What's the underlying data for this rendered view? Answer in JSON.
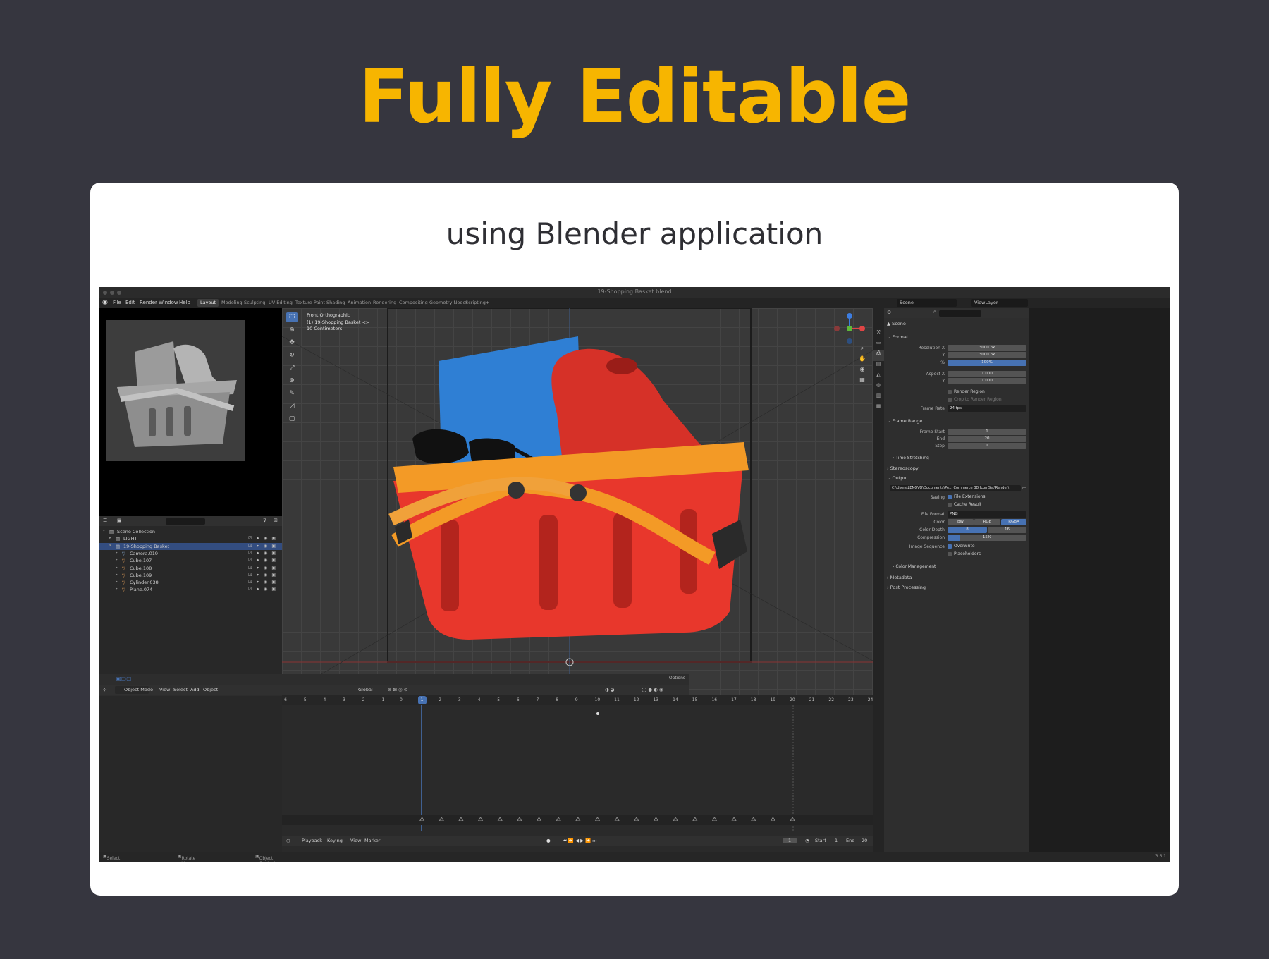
{
  "headline": "Fully Editable",
  "subtitle": "using Blender application",
  "colors": {
    "accent": "#f7b500",
    "background": "#36363f",
    "selection": "#4772b3"
  },
  "blender": {
    "window_title": "19-Shopping Basket.blend",
    "menus": [
      "File",
      "Edit",
      "Render",
      "Window",
      "Help"
    ],
    "workspaces": [
      "Layout",
      "Modeling",
      "Sculpting",
      "UV Editing",
      "Texture Paint",
      "Shading",
      "Animation",
      "Rendering",
      "Compositing",
      "Geometry Nodes",
      "Scripting",
      "+"
    ],
    "active_workspace": "Layout",
    "scene_field": "Scene",
    "view_layer_field": "ViewLayer",
    "outliner": {
      "rows": [
        {
          "label": "Scene Collection",
          "level": 0,
          "selected": false
        },
        {
          "label": "LIGHT",
          "level": 1,
          "selected": false
        },
        {
          "label": "19-Shopping Basket",
          "level": 1,
          "selected": true
        },
        {
          "label": "Camera.019",
          "level": 2,
          "selected": false
        },
        {
          "label": "Cube.107",
          "level": 2,
          "selected": false
        },
        {
          "label": "Cube.108",
          "level": 2,
          "selected": false
        },
        {
          "label": "Cube.109",
          "level": 2,
          "selected": false
        },
        {
          "label": "Cylinder.038",
          "level": 2,
          "selected": false
        },
        {
          "label": "Plane.074",
          "level": 2,
          "selected": false
        }
      ]
    },
    "viewport": {
      "info": [
        "Front Orthographic",
        "(1) 19-Shopping Basket <>",
        "10 Centimeters"
      ],
      "header": {
        "mode": "Object Mode",
        "menus": [
          "View",
          "Select",
          "Add",
          "Object"
        ],
        "orientation": "Global",
        "options": "Options"
      }
    },
    "timeline": {
      "ticks": [
        "-6",
        "-5",
        "-4",
        "-3",
        "-2",
        "-1",
        "0",
        "1",
        "2",
        "3",
        "4",
        "5",
        "6",
        "7",
        "8",
        "9",
        "10",
        "11",
        "12",
        "13",
        "14",
        "15",
        "16",
        "17",
        "18",
        "19",
        "20",
        "21",
        "22",
        "23",
        "24"
      ],
      "current_frame": "1",
      "footer": {
        "playback": "Playback",
        "keying": "Keying",
        "view": "View",
        "marker": "Marker",
        "frame": "1",
        "start_label": "Start",
        "start": "1",
        "end_label": "End",
        "end": "20"
      }
    },
    "properties": {
      "scene": "Scene",
      "format_title": "Format",
      "resolution_x_label": "Resolution X",
      "resolution_x": "3000 px",
      "y_label": "Y",
      "resolution_y": "3000 px",
      "percent_label": "%",
      "percent": "100%",
      "aspect_x_label": "Aspect X",
      "aspect_x": "1.000",
      "aspect_y": "1.000",
      "render_region": "Render Region",
      "crop_region": "Crop to Render Region",
      "frame_rate_label": "Frame Rate",
      "frame_rate": "24 fps",
      "frame_range_title": "Frame Range",
      "frame_start_label": "Frame Start",
      "frame_start": "1",
      "end_label": "End",
      "frame_end": "20",
      "step_label": "Step",
      "step": "1",
      "time_stretching": "Time Stretching",
      "stereoscopy": "Stereoscopy",
      "output_title": "Output",
      "output_path": "C:\\Users\\LENOVO\\Documents\\Pe... Commerce 3D Icon Set\\Render\\",
      "saving_label": "Saving",
      "file_extensions": "File Extensions",
      "cache_result": "Cache Result",
      "file_format_label": "File Format",
      "file_format": "PNG",
      "color_label": "Color",
      "color_options": [
        "BW",
        "RGB",
        "RGBA"
      ],
      "color_depth_label": "Color Depth",
      "color_depth": [
        "8",
        "16"
      ],
      "compression_label": "Compression",
      "compression": "15%",
      "image_sequence_label": "Image Sequence",
      "overwrite": "Overwrite",
      "placeholders": "Placeholders",
      "color_management": "Color Management",
      "metadata": "Metadata",
      "post_processing": "Post Processing"
    },
    "status": {
      "select": "Select",
      "rotate": "Rotate View",
      "context": "Object Context Menu",
      "version": "3.6.1"
    }
  }
}
